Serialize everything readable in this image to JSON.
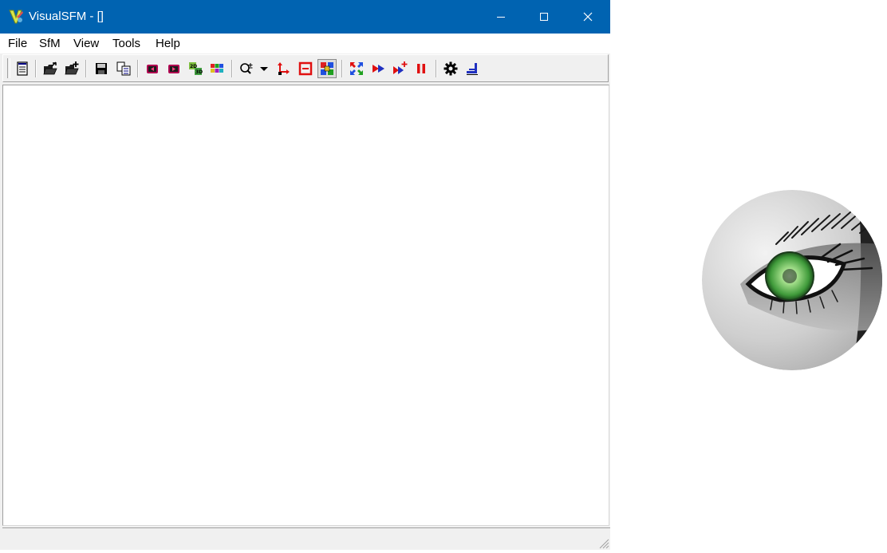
{
  "window": {
    "title": "VisualSFM - []",
    "icon": "visualsfm-app-icon",
    "controls": [
      "minimize-icon",
      "maximize-icon",
      "close-icon"
    ]
  },
  "menu": {
    "items": [
      {
        "label": "File"
      },
      {
        "label": "SfM"
      },
      {
        "label": "View"
      },
      {
        "label": "Tools"
      },
      {
        "label": "Help"
      }
    ]
  },
  "toolbar": {
    "groups": [
      [
        "log-window-icon"
      ],
      [
        "open-images-icon",
        "add-images-icon"
      ],
      [
        "save-icon",
        "copy-icon"
      ],
      [
        "show-previous-icon",
        "show-next-icon",
        "toggle-2d-3d-icon",
        "show-thumbnails-icon"
      ],
      [
        "zoom-icon",
        "dropdown-arrow-icon",
        "axes-icon",
        "feature-icon",
        "match-view-icon"
      ],
      [
        "compute-matches-icon",
        "reconstruct-sparse-icon",
        "reconstruct-resume-icon",
        "pause-icon"
      ],
      [
        "settings-gear-icon",
        "dense-reconstruct-icon"
      ]
    ],
    "pressed": "match-view-icon"
  },
  "status": {
    "text": ""
  },
  "colors": {
    "titlebar": "#0063b1",
    "window_bg": "#f0f0f0",
    "canvas_bg": "#ffffff"
  },
  "logo": {
    "icon": "eye-logo-icon"
  }
}
